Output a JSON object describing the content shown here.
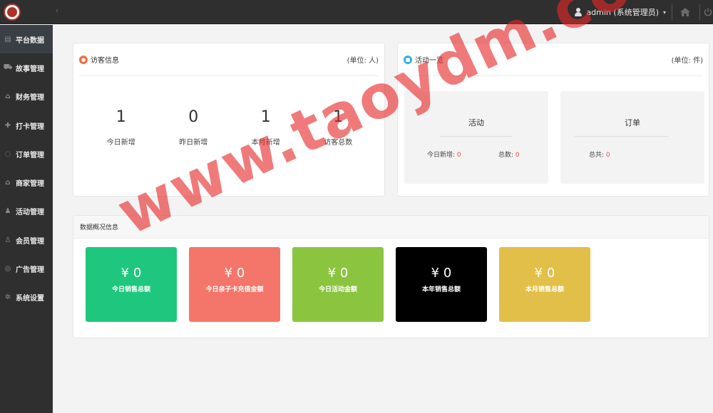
{
  "header": {
    "user_label": "admin (系统管理员)",
    "user_caret": "▾",
    "home_icon": "home-icon",
    "power_icon": "power-icon"
  },
  "sidebar": {
    "items": [
      {
        "label": "平台数据",
        "icon": "dashboard-icon",
        "glyph": "▤",
        "active": true
      },
      {
        "label": "故事管理",
        "icon": "cart-icon",
        "glyph": "⛟",
        "active": false
      },
      {
        "label": "财务管理",
        "icon": "bank-icon",
        "glyph": "⌂",
        "active": false
      },
      {
        "label": "打卡管理",
        "icon": "gift-icon",
        "glyph": "✚",
        "active": false
      },
      {
        "label": "订单管理",
        "icon": "comment-icon",
        "glyph": "◌",
        "active": false
      },
      {
        "label": "商家管理",
        "icon": "bank-icon",
        "glyph": "⌂",
        "active": false
      },
      {
        "label": "活动管理",
        "icon": "bell-icon",
        "glyph": "♟",
        "active": false
      },
      {
        "label": "会员管理",
        "icon": "user-icon",
        "glyph": "♙",
        "active": false
      },
      {
        "label": "广告管理",
        "icon": "lifebuoy-icon",
        "glyph": "◎",
        "active": false
      },
      {
        "label": "系统设置",
        "icon": "gear-icon",
        "glyph": "✲",
        "active": false
      }
    ]
  },
  "visitors": {
    "title": "访客信息",
    "unit": "(单位: 人)",
    "stats": [
      {
        "value": "1",
        "label": "今日新增"
      },
      {
        "value": "0",
        "label": "昨日新增"
      },
      {
        "value": "1",
        "label": "本月新增"
      },
      {
        "value": "1",
        "label": "访客总数"
      }
    ]
  },
  "activity": {
    "title": "活动一览",
    "unit": "(单位: 件)",
    "card1": {
      "title": "活动",
      "today_label": "今日新增:",
      "today_value": "0",
      "total_label": "总数:",
      "total_value": "0"
    },
    "card2": {
      "title": "订单",
      "total_label": "总共:",
      "total_value": "0"
    }
  },
  "overview": {
    "title": "数据概况信息",
    "tiles": [
      {
        "value": "¥ 0",
        "label": "今日销售总额",
        "color": "#1fc77e"
      },
      {
        "value": "¥ 0",
        "label": "今日亲子卡充值金额",
        "color": "#f4766a"
      },
      {
        "value": "¥ 0",
        "label": "今日活动金额",
        "color": "#8bc540"
      },
      {
        "value": "¥ 0",
        "label": "本年销售总额",
        "color": "#000000"
      },
      {
        "value": "¥ 0",
        "label": "本月销售总额",
        "color": "#e2bf48"
      }
    ]
  },
  "watermark": "www.taoydm.com"
}
